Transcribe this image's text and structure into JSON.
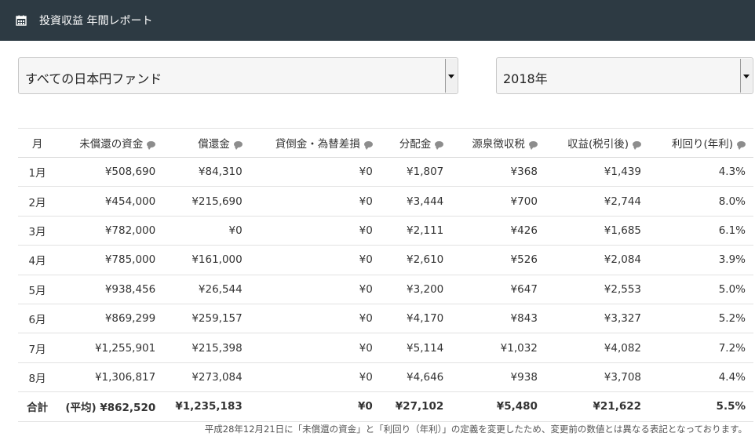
{
  "header": {
    "icon": "calendar-icon",
    "title": "投資収益 年間レポート"
  },
  "filters": {
    "fund": "すべての日本円ファンド",
    "year": "2018年"
  },
  "table": {
    "columns": [
      "月",
      "未償還の資金",
      "償還金",
      "貸倒金・為替差損",
      "分配金",
      "源泉徴収税",
      "収益(税引後)",
      "利回り(年利)"
    ],
    "rows": [
      [
        "1月",
        "¥508,690",
        "¥84,310",
        "¥0",
        "¥1,807",
        "¥368",
        "¥1,439",
        "4.3%"
      ],
      [
        "2月",
        "¥454,000",
        "¥215,690",
        "¥0",
        "¥3,444",
        "¥700",
        "¥2,744",
        "8.0%"
      ],
      [
        "3月",
        "¥782,000",
        "¥0",
        "¥0",
        "¥2,111",
        "¥426",
        "¥1,685",
        "6.1%"
      ],
      [
        "4月",
        "¥785,000",
        "¥161,000",
        "¥0",
        "¥2,610",
        "¥526",
        "¥2,084",
        "3.9%"
      ],
      [
        "5月",
        "¥938,456",
        "¥26,544",
        "¥0",
        "¥3,200",
        "¥647",
        "¥2,553",
        "5.0%"
      ],
      [
        "6月",
        "¥869,299",
        "¥259,157",
        "¥0",
        "¥4,170",
        "¥843",
        "¥3,327",
        "5.2%"
      ],
      [
        "7月",
        "¥1,255,901",
        "¥215,398",
        "¥0",
        "¥5,114",
        "¥1,032",
        "¥4,082",
        "7.2%"
      ],
      [
        "8月",
        "¥1,306,817",
        "¥273,084",
        "¥0",
        "¥4,646",
        "¥938",
        "¥3,708",
        "4.4%"
      ]
    ],
    "total": [
      "合計",
      "(平均) ¥862,520",
      "¥1,235,183",
      "¥0",
      "¥27,102",
      "¥5,480",
      "¥21,622",
      "5.5%"
    ]
  },
  "note": "平成28年12月21日に「未償還の資金」と「利回り（年利）」の定義を変更したため、変更前の数値とは異なる表記となっております。"
}
